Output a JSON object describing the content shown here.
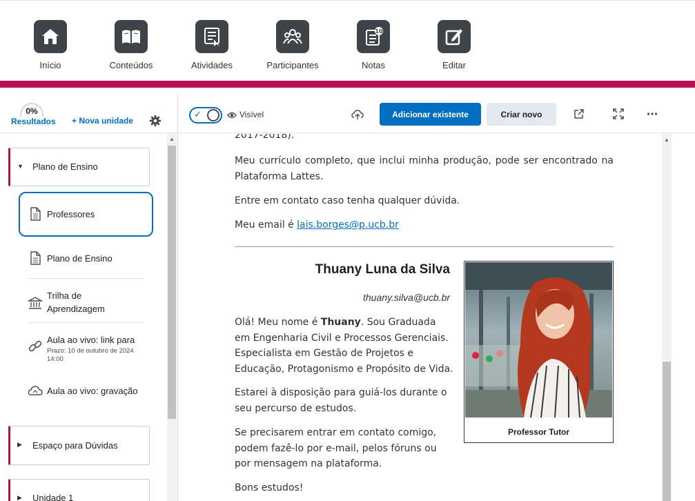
{
  "nav": {
    "items": [
      {
        "label": "Início",
        "icon": "home-icon"
      },
      {
        "label": "Conteúdos",
        "icon": "book-icon"
      },
      {
        "label": "Atividades",
        "icon": "activities-icon"
      },
      {
        "label": "Participantes",
        "icon": "participants-icon"
      },
      {
        "label": "Notas",
        "icon": "grades-icon"
      },
      {
        "label": "Editar",
        "icon": "edit-icon"
      }
    ],
    "accent_color": "#b5124f"
  },
  "sidebar": {
    "progress_percent": "0%",
    "progress_label": "Resultados",
    "new_unit": "+ Nova unidade",
    "units": [
      {
        "label": "Plano de Ensino",
        "expanded": true
      },
      {
        "label": "Espaço para Dúvidas",
        "expanded": false
      },
      {
        "label": "Unidade 1",
        "expanded": false
      }
    ],
    "lessons": [
      {
        "label": "Professores",
        "icon": "document-icon",
        "selected": true
      },
      {
        "label": "Plano de Ensino",
        "icon": "document-icon"
      },
      {
        "label_line1": "Trilha de",
        "label_line2": "Aprendizagem",
        "icon": "institution-icon"
      },
      {
        "label": "Aula ao vivo: link para",
        "due": "Prazo: 10 de outubro de 2024",
        "due_time": "14:00",
        "icon": "link-icon"
      },
      {
        "label": "Aula ao vivo: gravação",
        "icon": "cloud-icon"
      }
    ]
  },
  "toolbar": {
    "visibility": "Visível",
    "add_existing": "Adicionar existente",
    "create_new": "Criar novo",
    "primary_color": "#006fbf"
  },
  "content": {
    "top_fragment": "2017-2018).",
    "p_curriculum": "Meu currículo completo, que inclui minha produção, pode ser encontrado na Plataforma Lattes.",
    "p_contact": "Entre em contato caso tenha qualquer dúvida.",
    "p_email_prefix": "Meu email é ",
    "email_link": "lais.borges@p.ucb.br",
    "tutor": {
      "name": "Thuany Luna da Silva",
      "email": "thuany.silva@ucb.br",
      "p1_prefix": "Olá!  Meu nome é ",
      "p1_name": "Thuany",
      "p1_suffix": ". Sou Graduada em Engenharia Civil e Processos Gerenciais. Especialista em Gestão de Projetos e Educação, Protagonismo e Propósito de Vida.",
      "p2": "Estarei à disposição para guiá-los durante o seu percurso de estudos.",
      "p3": "Se precisarem entrar em contato comigo, podem fazê-lo por e-mail, pelos fóruns ou por mensagem na plataforma.",
      "p4": "Bons estudos!",
      "photo_caption": "Professor Tutor"
    }
  }
}
